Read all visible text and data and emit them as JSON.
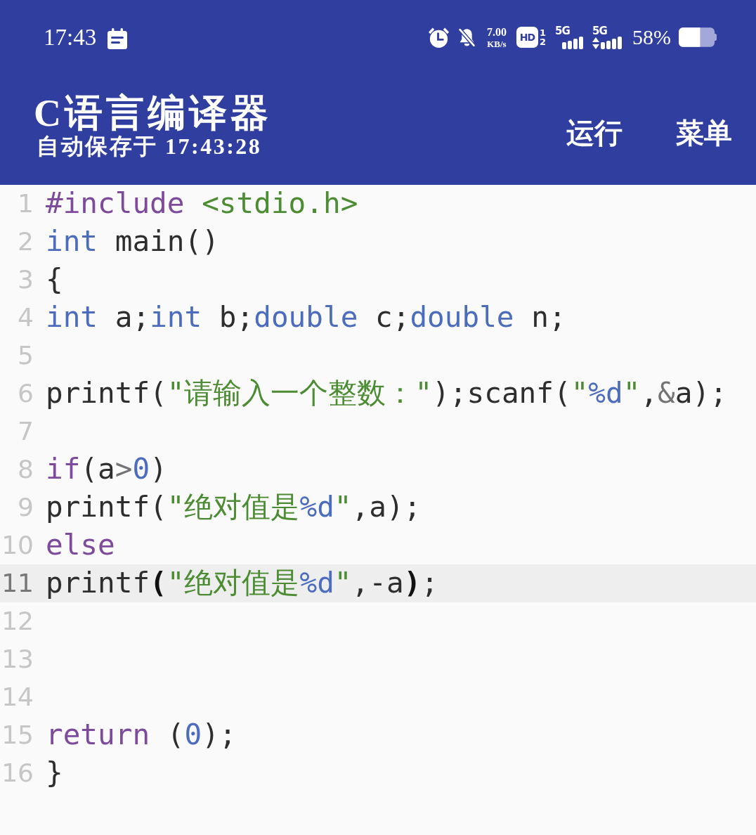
{
  "status_bar": {
    "time": "17:43",
    "network_speed": {
      "value": "7.00",
      "unit": "KB/s"
    },
    "hd_badge": {
      "label": "HD",
      "sims": [
        "1",
        "2"
      ]
    },
    "signals": [
      {
        "label": "5G",
        "data_active": false
      },
      {
        "label": "5G",
        "data_active": true
      }
    ],
    "battery": "58%"
  },
  "app_bar": {
    "title": "C语言编译器",
    "subtitle": "自动保存于 17:43:28",
    "actions": [
      "运行",
      "菜单"
    ]
  },
  "editor": {
    "lines": [
      {
        "number": "1",
        "current": false,
        "tokens": [
          {
            "kind": "preprocessor",
            "text": "#include "
          },
          {
            "kind": "header",
            "text": "<stdio.h>"
          }
        ]
      },
      {
        "number": "2",
        "current": false,
        "tokens": [
          {
            "kind": "type",
            "text": "int"
          },
          {
            "kind": "plain",
            "text": " main()"
          }
        ]
      },
      {
        "number": "3",
        "current": false,
        "tokens": [
          {
            "kind": "plain",
            "text": "{"
          }
        ]
      },
      {
        "number": "4",
        "current": false,
        "tokens": [
          {
            "kind": "type",
            "text": "int"
          },
          {
            "kind": "plain",
            "text": " a;"
          },
          {
            "kind": "type",
            "text": "int"
          },
          {
            "kind": "plain",
            "text": " b;"
          },
          {
            "kind": "type",
            "text": "double"
          },
          {
            "kind": "plain",
            "text": " c;"
          },
          {
            "kind": "type",
            "text": "double"
          },
          {
            "kind": "plain",
            "text": " n;"
          }
        ]
      },
      {
        "number": "5",
        "current": false
      },
      {
        "number": "6",
        "current": false,
        "tokens": [
          {
            "kind": "plain",
            "text": "printf("
          },
          {
            "kind": "string",
            "text": "\"请输入一个整数：\""
          },
          {
            "kind": "plain",
            "text": ");scanf("
          },
          {
            "kind": "string",
            "text": "\""
          },
          {
            "kind": "format",
            "text": "%d"
          },
          {
            "kind": "string",
            "text": "\""
          },
          {
            "kind": "plain",
            "text": ","
          },
          {
            "kind": "operator",
            "text": "&"
          },
          {
            "kind": "plain",
            "text": "a);"
          }
        ]
      },
      {
        "number": "7",
        "current": false
      },
      {
        "number": "8",
        "current": false,
        "tokens": [
          {
            "kind": "keyword",
            "text": "if"
          },
          {
            "kind": "plain",
            "text": "(a"
          },
          {
            "kind": "operator",
            "text": ">"
          },
          {
            "kind": "number",
            "text": "0"
          },
          {
            "kind": "plain",
            "text": ")"
          }
        ]
      },
      {
        "number": "9",
        "current": false,
        "tokens": [
          {
            "kind": "plain",
            "text": "printf("
          },
          {
            "kind": "string",
            "text": "\"绝对值是"
          },
          {
            "kind": "format",
            "text": "%d"
          },
          {
            "kind": "string",
            "text": "\""
          },
          {
            "kind": "plain",
            "text": ",a);"
          }
        ]
      },
      {
        "number": "10",
        "current": false,
        "tokens": [
          {
            "kind": "keyword",
            "text": "else"
          }
        ]
      },
      {
        "number": "11",
        "current": true,
        "tokens": [
          {
            "kind": "plain",
            "text": "printf"
          },
          {
            "kind": "matched_bracket",
            "text": "("
          },
          {
            "kind": "string",
            "text": "\"绝对值是"
          },
          {
            "kind": "format",
            "text": "%d"
          },
          {
            "kind": "string",
            "text": "\""
          },
          {
            "kind": "plain",
            "text": ",-a"
          },
          {
            "kind": "matched_bracket",
            "text": ")"
          },
          {
            "kind": "plain",
            "text": ";"
          }
        ]
      },
      {
        "number": "12",
        "current": false
      },
      {
        "number": "13",
        "current": false
      },
      {
        "number": "14",
        "current": false
      },
      {
        "number": "15",
        "current": false,
        "tokens": [
          {
            "kind": "keyword",
            "text": "return"
          },
          {
            "kind": "plain",
            "text": " ("
          },
          {
            "kind": "number",
            "text": "0"
          },
          {
            "kind": "plain",
            "text": ");"
          }
        ]
      },
      {
        "number": "16",
        "current": false,
        "tokens": [
          {
            "kind": "plain",
            "text": "}"
          }
        ]
      }
    ]
  }
}
